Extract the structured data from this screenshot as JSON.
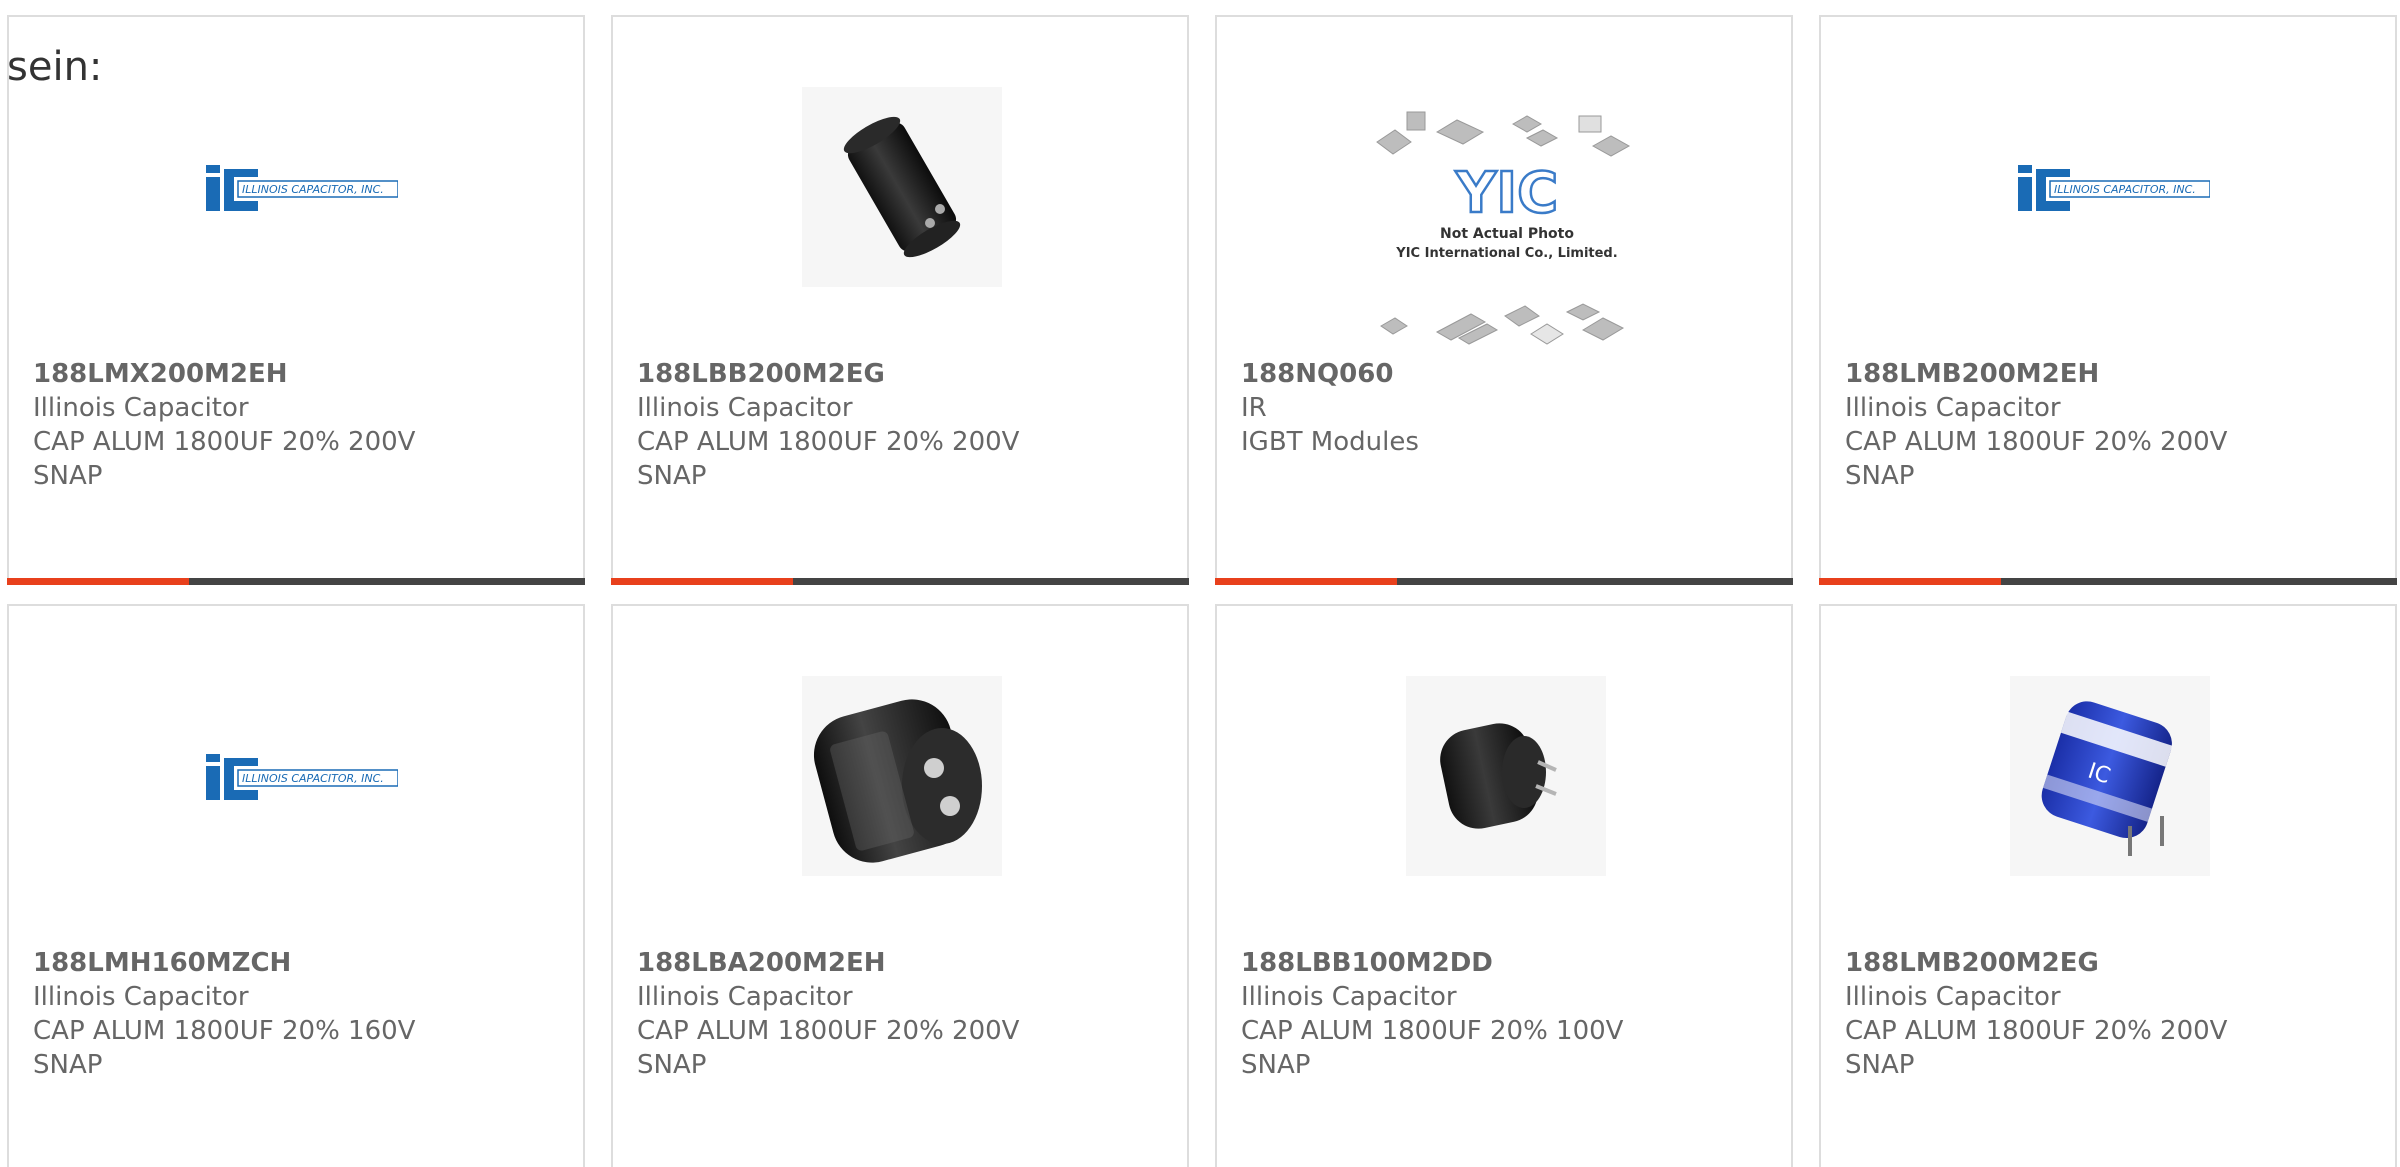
{
  "intro_text": "sein:",
  "colors": {
    "accent": "#e8401c",
    "bar_dark": "#444444",
    "card_border": "#dddddd",
    "text_gray": "#666666",
    "logo_blue": "#1a6bb5"
  },
  "products": [
    {
      "part_number": "188LMX200M2EH",
      "manufacturer": "Illinois Capacitor",
      "description_line1": "CAP ALUM 1800UF 20% 200V",
      "description_line2": "SNAP",
      "image": "illinois-capacitor-logo",
      "logo_text": "ILLINOIS CAPACITOR, INC."
    },
    {
      "part_number": "188LBB200M2EG",
      "manufacturer": "Illinois Capacitor",
      "description_line1": "CAP ALUM 1800UF 20% 200V",
      "description_line2": "SNAP",
      "image": "black-electrolytic-capacitor-photo"
    },
    {
      "part_number": "188NQ060",
      "manufacturer": "IR",
      "description_line1": "IGBT Modules",
      "description_line2": "",
      "image": "yic-placeholder-photo",
      "placeholder_brand": "YIC",
      "placeholder_line1": "Not Actual Photo",
      "placeholder_line2": "YIC International Co., Limited."
    },
    {
      "part_number": "188LMB200M2EH",
      "manufacturer": "Illinois Capacitor",
      "description_line1": "CAP ALUM 1800UF 20% 200V",
      "description_line2": "SNAP",
      "image": "illinois-capacitor-logo",
      "logo_text": "ILLINOIS CAPACITOR, INC."
    },
    {
      "part_number": "188LMH160MZCH",
      "manufacturer": "Illinois Capacitor",
      "description_line1": "CAP ALUM 1800UF 20% 160V",
      "description_line2": "SNAP",
      "image": "illinois-capacitor-logo",
      "logo_text": "ILLINOIS CAPACITOR, INC."
    },
    {
      "part_number": "188LBA200M2EH",
      "manufacturer": "Illinois Capacitor",
      "description_line1": "CAP ALUM 1800UF 20% 200V",
      "description_line2": "SNAP",
      "image": "black-snap-in-capacitor-photo"
    },
    {
      "part_number": "188LBB100M2DD",
      "manufacturer": "Illinois Capacitor",
      "description_line1": "CAP ALUM 1800UF 20% 100V",
      "description_line2": "SNAP",
      "image": "small-black-capacitor-photo"
    },
    {
      "part_number": "188LMB200M2EG",
      "manufacturer": "Illinois Capacitor",
      "description_line1": "CAP ALUM 1800UF 20% 200V",
      "description_line2": "SNAP",
      "image": "blue-capacitor-photo",
      "capacitor_label": "IC"
    }
  ]
}
